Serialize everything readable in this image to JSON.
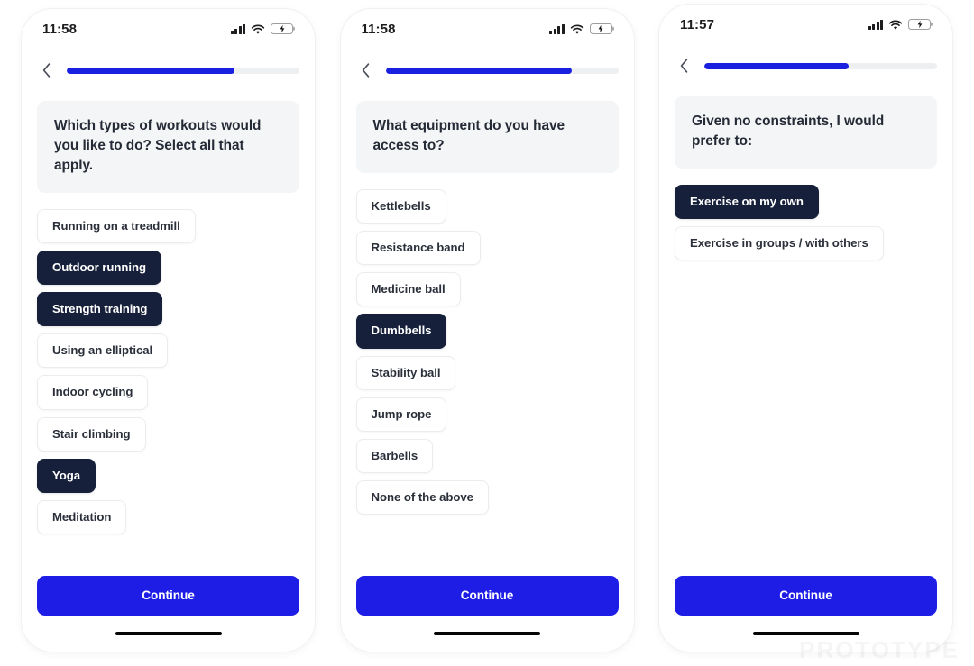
{
  "app": {
    "accent_blue": "#1d1de6",
    "selected_dark": "#16203a",
    "card_gray": "#f4f5f7",
    "track_gray": "#eeeff1"
  },
  "watermark": {
    "text": "PROTOTYPE"
  },
  "screens": [
    {
      "id": "workout-types",
      "status": {
        "time": "11:58",
        "battery_label": "charging",
        "wifi_label": "wifi-full",
        "signal_label": "signal-full"
      },
      "back_label": "Back",
      "progress": {
        "percent": 72,
        "value_label": "72%"
      },
      "question": "Which types of workouts would you like to do? Select all that apply.",
      "options": [
        {
          "label": "Running on a treadmill",
          "selected": false
        },
        {
          "label": "Outdoor running",
          "selected": true
        },
        {
          "label": "Strength training",
          "selected": true
        },
        {
          "label": "Using an elliptical",
          "selected": false
        },
        {
          "label": "Indoor cycling",
          "selected": false
        },
        {
          "label": "Stair climbing",
          "selected": false
        },
        {
          "label": "Yoga",
          "selected": true
        },
        {
          "label": "Meditation",
          "selected": false
        }
      ],
      "continue_label": "Continue"
    },
    {
      "id": "equipment-access",
      "status": {
        "time": "11:58",
        "battery_label": "charging",
        "wifi_label": "wifi-full",
        "signal_label": "signal-full"
      },
      "back_label": "Back",
      "progress": {
        "percent": 80,
        "value_label": "80%"
      },
      "question": "What equipment do you have access to?",
      "options": [
        {
          "label": "Kettlebells",
          "selected": false
        },
        {
          "label": "Resistance band",
          "selected": false
        },
        {
          "label": "Medicine ball",
          "selected": false
        },
        {
          "label": "Dumbbells",
          "selected": true
        },
        {
          "label": "Stability ball",
          "selected": false
        },
        {
          "label": "Jump rope",
          "selected": false
        },
        {
          "label": "Barbells",
          "selected": false
        },
        {
          "label": "None of the above",
          "selected": false
        }
      ],
      "continue_label": "Continue"
    },
    {
      "id": "exercise-preference",
      "status": {
        "time": "11:57",
        "battery_label": "charging",
        "wifi_label": "wifi-full",
        "signal_label": "signal-full"
      },
      "back_label": "Back",
      "progress": {
        "percent": 62,
        "value_label": "62%"
      },
      "question": "Given no constraints, I would prefer to:",
      "options": [
        {
          "label": "Exercise on my own",
          "selected": true
        },
        {
          "label": "Exercise in groups / with others",
          "selected": false
        }
      ],
      "continue_label": "Continue"
    }
  ]
}
